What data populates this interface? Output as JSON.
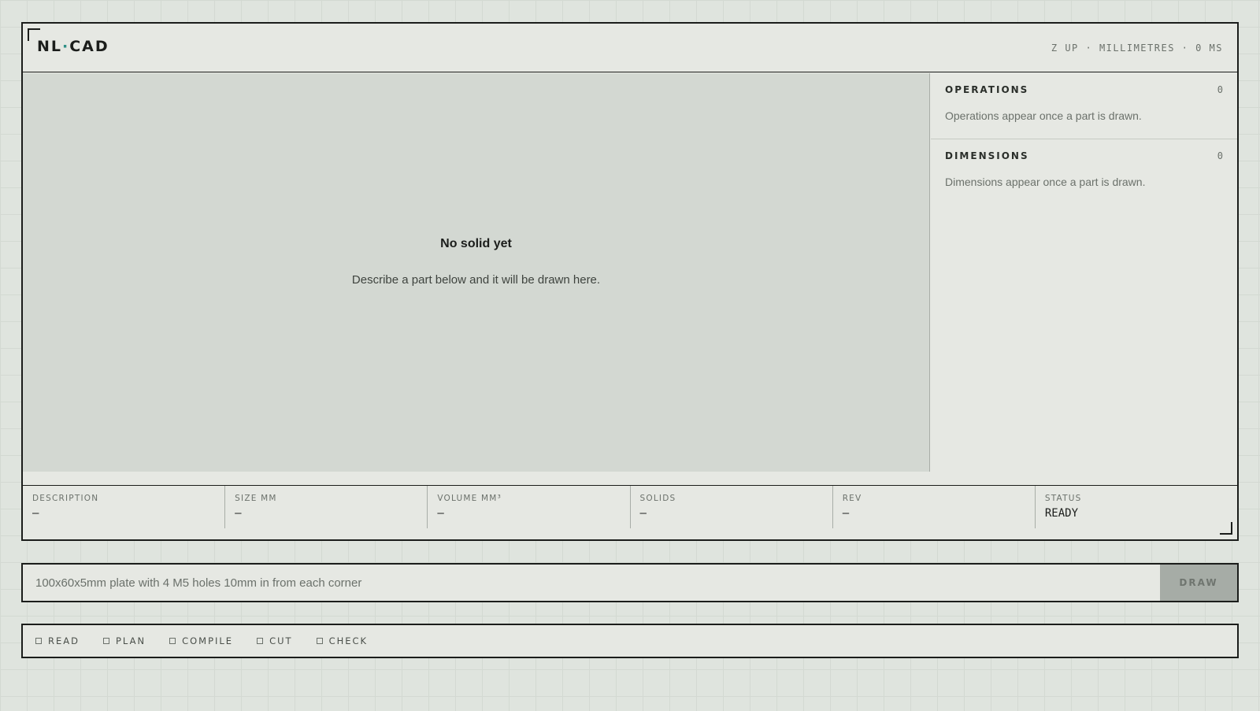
{
  "app": {
    "logo_left": "NL",
    "logo_dot": "·",
    "logo_right": "CAD"
  },
  "header": {
    "meta": "Z UP · MILLIMETRES · 0 MS"
  },
  "viewport": {
    "empty_title": "No solid yet",
    "empty_subtitle": "Describe a part below and it will be drawn here."
  },
  "sidebar": {
    "operations": {
      "title": "OPERATIONS",
      "count": "0",
      "empty_text": "Operations appear once a part is drawn."
    },
    "dimensions": {
      "title": "DIMENSIONS",
      "count": "0",
      "empty_text": "Dimensions appear once a part is drawn."
    }
  },
  "stats": [
    {
      "label": "DESCRIPTION",
      "value": "–"
    },
    {
      "label": "SIZE MM",
      "value": "–"
    },
    {
      "label": "VOLUME MM³",
      "value": "–"
    },
    {
      "label": "SOLIDS",
      "value": "–"
    },
    {
      "label": "REV",
      "value": "–"
    },
    {
      "label": "STATUS",
      "value": "READY"
    }
  ],
  "prompt": {
    "placeholder": "100x60x5mm plate with 4 M5 holes 10mm in from each corner",
    "value": "",
    "button_label": "DRAW"
  },
  "pipeline": {
    "steps": [
      {
        "label": "READ"
      },
      {
        "label": "PLAN"
      },
      {
        "label": "COMPILE"
      },
      {
        "label": "CUT"
      },
      {
        "label": "CHECK"
      }
    ]
  },
  "colors": {
    "accent": "#2f8f86",
    "ink": "#1b1d1b",
    "muted": "#6b716b",
    "button_disabled": "#a6aca6"
  }
}
